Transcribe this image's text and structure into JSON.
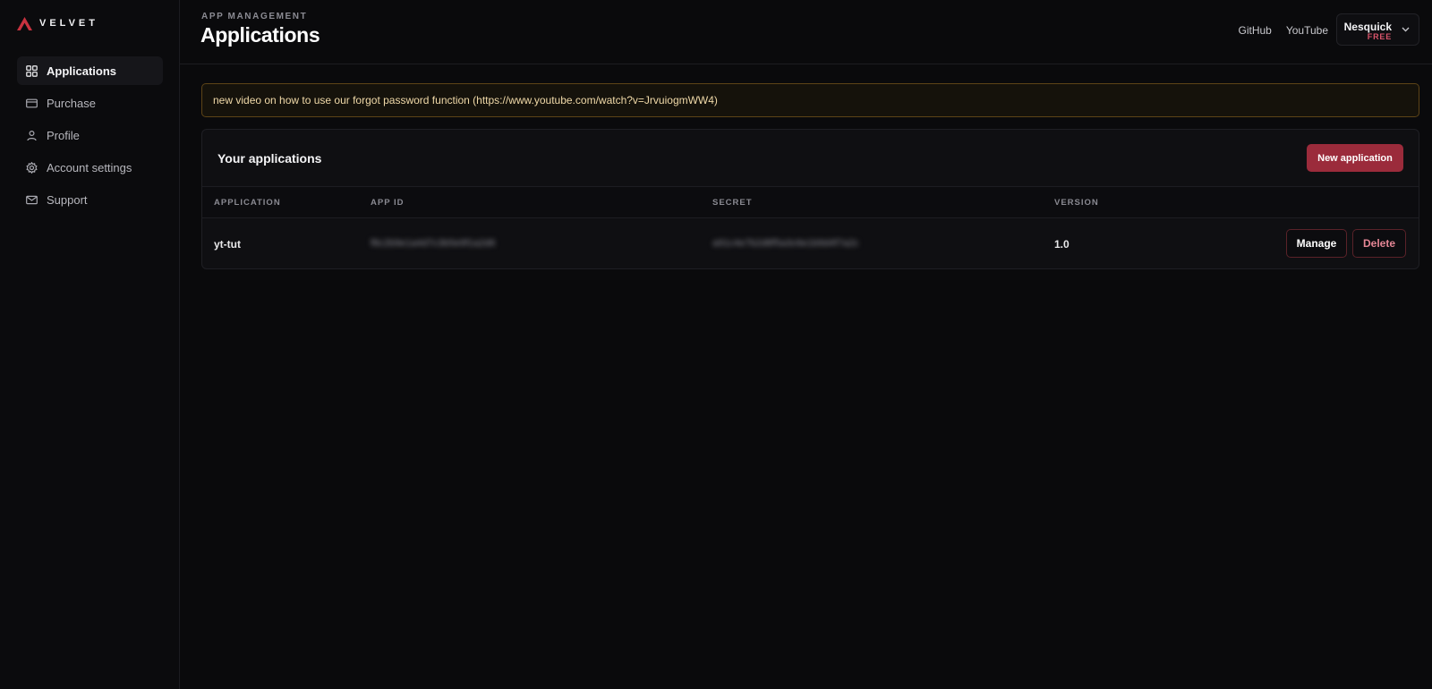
{
  "brand": {
    "name": "VELVET",
    "accent": "#c8323f"
  },
  "sidebar": {
    "items": [
      {
        "label": "Applications",
        "icon": "grid-icon",
        "active": true
      },
      {
        "label": "Purchase",
        "icon": "credit-card-icon",
        "active": false
      },
      {
        "label": "Profile",
        "icon": "user-icon",
        "active": false
      },
      {
        "label": "Account settings",
        "icon": "gear-icon",
        "active": false
      },
      {
        "label": "Support",
        "icon": "mail-icon",
        "active": false
      }
    ]
  },
  "header": {
    "eyebrow": "APP MANAGEMENT",
    "title": "Applications",
    "links": [
      "GitHub",
      "YouTube"
    ],
    "user": {
      "name": "Nesquick",
      "plan": "FREE"
    }
  },
  "notice": {
    "text": "new video on how to use our forgot password function (https://www.youtube.com/watch?v=JrvuiogmWW4)"
  },
  "apps_panel": {
    "title": "Your applications",
    "new_button": "New application",
    "columns": [
      "APPLICATION",
      "APP ID",
      "SECRET",
      "VERSION"
    ],
    "rows": [
      {
        "name": "yt-tut",
        "app_id": "f8c2b9e1a4d7c3b5e9f1a2d6",
        "secret": "a91c4e7b2d8f5a3c6e1b9d4f7a2c",
        "version": "1.0",
        "actions": [
          "Manage",
          "Delete"
        ]
      }
    ]
  }
}
